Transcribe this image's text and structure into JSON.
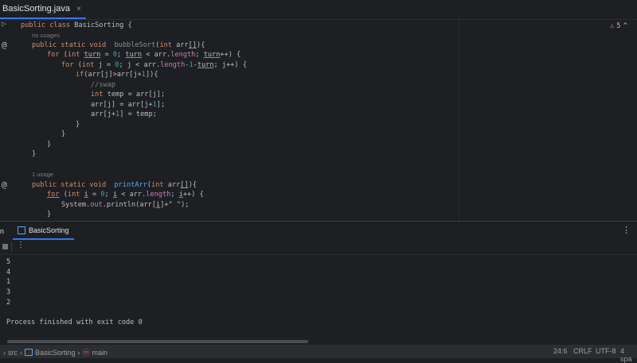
{
  "editor_tab": {
    "filename": "BasicSorting.java",
    "close": "×"
  },
  "inspection": {
    "warnings": "5",
    "chevron": "^"
  },
  "code": {
    "l1": {
      "kw": "public class",
      "rest": " BasicSorting {"
    },
    "hint1": "no usages",
    "l2": {
      "kw": "public static void",
      "fn": "bubbleSort",
      "a": "(",
      "kw2": "int",
      "b": " arr",
      "c": "[]",
      "d": "){"
    },
    "l3": {
      "kw": "for",
      "a": " (",
      "kw2": "int",
      "b": " ",
      "v1": "turn",
      "c": " = ",
      "n": "0",
      "d": "; ",
      "v2": "turn",
      "e": " < arr.",
      "f": "length",
      "g": "; ",
      "v3": "turn",
      "h": "++) {"
    },
    "l4": {
      "kw": "for",
      "a": " (",
      "kw2": "int",
      "b": " j = ",
      "n": "0",
      "c": "; j < arr.",
      "f": "length",
      "d": "-",
      "n2": "1",
      "e": "-",
      "v": "turn",
      "g": "; j++) {"
    },
    "l5": {
      "kw": "if",
      "a": "(arr[j]>arr[j+",
      "n": "1",
      "b": "]){"
    },
    "l6": {
      "cm": "//swap"
    },
    "l7": {
      "kw": "int",
      "rest": " temp = arr[j];"
    },
    "l8": {
      "text": "arr[j] = arr[j+",
      "n": "1",
      "b": "];"
    },
    "l9": {
      "text": "arr[j+",
      "n": "1",
      "b": "] = temp;"
    },
    "brace": "}",
    "hint2": "1 usage",
    "l14": {
      "kw": "public static void",
      "fn": "printArr",
      "a": "(",
      "kw2": "int",
      "b": " arr",
      "c": "[]",
      "d": "){"
    },
    "l15": {
      "kw": "for",
      "a": " (",
      "kw2": "int",
      "b": " ",
      "v1": "i",
      "c": " = ",
      "n": "0",
      "d": "; ",
      "v2": "i",
      "e": " < arr.",
      "f": "length",
      "g": "; ",
      "v3": "i",
      "h": "++) {"
    },
    "l16": {
      "a": "System.",
      "out": "out",
      "b": ".println(arr[",
      "v": "i",
      "c": "]+\" \");"
    },
    "l17": "}"
  },
  "run_panel": {
    "label_fragment": "n",
    "tab": "BasicSorting",
    "menu": "⋮",
    "toolbar_more": "⋮",
    "output": [
      "5",
      "4",
      "1",
      "3",
      "2"
    ],
    "finished": "Process finished with exit code 0"
  },
  "statusbar": {
    "crumbs": [
      "src",
      "BasicSorting",
      "main"
    ],
    "sep": "›",
    "position": "24:6",
    "line_sep": "CRLF",
    "encoding": "UTF-8",
    "indent": "4 spa"
  }
}
